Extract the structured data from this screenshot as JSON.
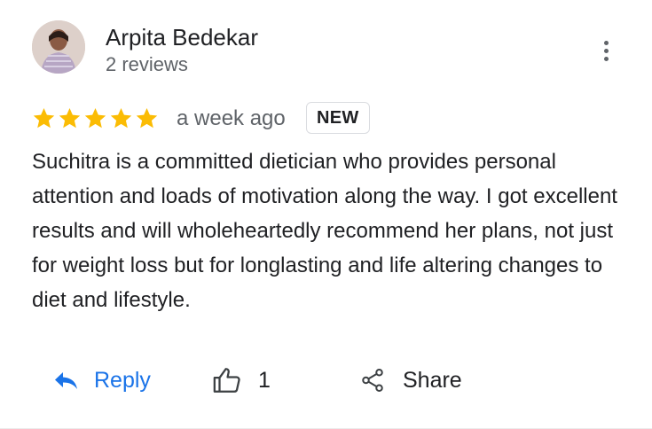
{
  "reviewer": {
    "name": "Arpita Bedekar",
    "review_count": "2 reviews"
  },
  "review": {
    "rating": 5,
    "max_rating": 5,
    "time": "a week ago",
    "badge": "NEW",
    "text": "Suchitra is a committed dietician who provides personal attention and loads of motivation along the way. I got excellent results and will wholeheartedly recommend her plans, not just for weight loss but for longlasting and life altering changes to diet and lifestyle."
  },
  "actions": {
    "reply_label": "Reply",
    "like_count": "1",
    "share_label": "Share"
  },
  "colors": {
    "star": "#fbbc04",
    "accent": "#1a73e8",
    "secondary_text": "#5f6368"
  },
  "icons": [
    "more-vert-icon",
    "star-icon",
    "reply-icon",
    "thumb-up-icon",
    "share-icon"
  ]
}
